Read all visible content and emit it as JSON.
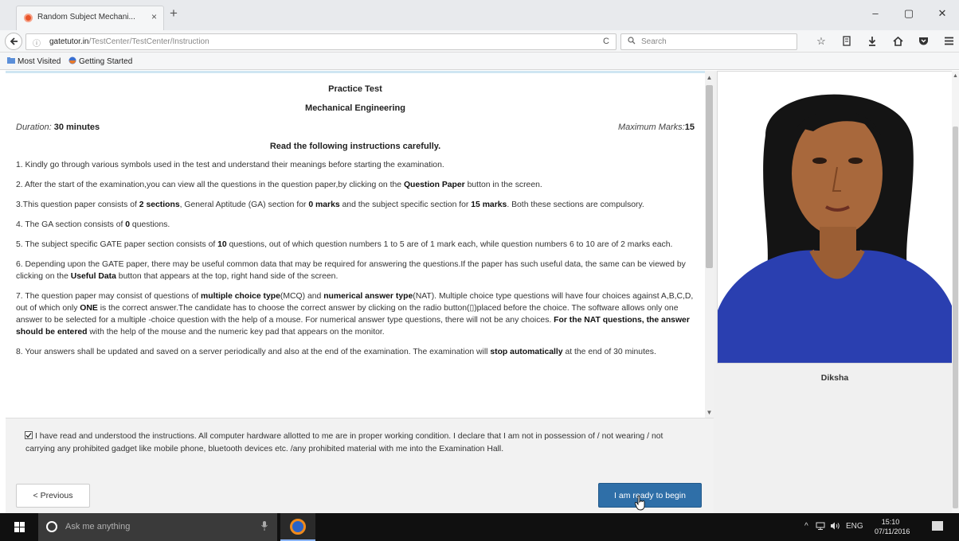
{
  "browser": {
    "tab_title": "Random Subject Mechani...",
    "tab_close": "×",
    "new_tab": "+",
    "window_controls": [
      "–",
      "▢",
      "✕"
    ],
    "url_info": "ⓘ",
    "url_host": "gatetutor.in",
    "url_path": "/TestCenter/TestCenter/Instruction",
    "reload": "C",
    "search_placeholder": "Search",
    "toolbar_icons": [
      "star-icon",
      "reading-list-icon",
      "download-icon",
      "home-icon",
      "pocket-icon",
      "menu-icon"
    ],
    "bookmarks": [
      "Most Visited",
      "Getting Started"
    ]
  },
  "test": {
    "title": "Practice Test",
    "subject": "Mechanical Engineering",
    "duration_label": "Duration:",
    "duration_value": "30 minutes",
    "marks_label": "Maximum Marks:",
    "marks_value": "15",
    "read_heading": "Read the following instructions carefully.",
    "instructions": [
      {
        "parts": [
          {
            "t": "1. Kindly go through various symbols used in the test and understand their meanings before starting the examination."
          }
        ]
      },
      {
        "parts": [
          {
            "t": "2. After the start of the examination,you can view all the questions in the question paper,by clicking on the "
          },
          {
            "t": "Question Paper",
            "b": true
          },
          {
            "t": " button in the screen."
          }
        ]
      },
      {
        "parts": [
          {
            "t": "3.This question paper consists of "
          },
          {
            "t": "2 sections",
            "b": true
          },
          {
            "t": ", General Aptitude (GA) section for "
          },
          {
            "t": "0 marks",
            "b": true
          },
          {
            "t": " and the subject specific section for "
          },
          {
            "t": "15 marks",
            "b": true
          },
          {
            "t": ". Both these sections are compulsory."
          }
        ]
      },
      {
        "parts": [
          {
            "t": "4. The GA section consists of "
          },
          {
            "t": "0",
            "b": true
          },
          {
            "t": " questions."
          }
        ]
      },
      {
        "parts": [
          {
            "t": "5. The subject specific GATE paper section consists of "
          },
          {
            "t": "10",
            "b": true
          },
          {
            "t": " questions, out of which question numbers 1 to 5 are of 1 mark each, while question numbers 6 to 10 are of 2 marks each."
          }
        ]
      },
      {
        "parts": [
          {
            "t": "6. Depending upon the GATE paper, there may be useful common data that may be required for answering the questions.If the paper has such useful data, the same can be viewed by clicking on the "
          },
          {
            "t": "Useful Data",
            "b": true
          },
          {
            "t": " button that appears at the top, right hand side of the screen."
          }
        ]
      },
      {
        "parts": [
          {
            "t": "7. The question paper may consist of questions of "
          },
          {
            "t": "multiple choice type",
            "b": true
          },
          {
            "t": "(MCQ) and "
          },
          {
            "t": "numerical answer type",
            "b": true
          },
          {
            "t": "(NAT). Multiple choice type questions will have four choices against A,B,C,D, out of which only "
          },
          {
            "t": "ONE",
            "b": true
          },
          {
            "t": " is the correct answer.The candidate has to choose the correct answer by clicking on the radio button(▯)placed before the choice. The software allows only one answer to be selected for a multiple -choice question with the help of a mouse. For numerical answer type questions, there will not be any choices. "
          },
          {
            "t": "For the NAT questions, the answer should be entered",
            "b": true
          },
          {
            "t": " with the help of the mouse and the numeric key pad that appears on the monitor."
          }
        ]
      },
      {
        "parts": [
          {
            "t": "8. Your answers shall be updated and saved on a server periodically and also at the end of the examination. The examination will "
          },
          {
            "t": "stop automatically",
            "b": true
          },
          {
            "t": " at the end of 30 minutes."
          }
        ]
      }
    ],
    "agreement": "I have read and understood the instructions. All computer hardware allotted to me are in proper working condition. I declare that I am not in possession of / not wearing / not carrying any prohibited gadget like mobile phone, bluetooth devices etc. /any prohibited material with me into the Examination Hall.",
    "agreement_checked": true,
    "previous_label": "< Previous",
    "ready_label": "I am ready to begin"
  },
  "candidate": {
    "name": "Diksha"
  },
  "taskbar": {
    "search_placeholder": "Ask me anything",
    "tray_lang": "ENG",
    "time": "15:10",
    "date": "07/11/2016"
  },
  "colors": {
    "primary_button": "#2f6fa8",
    "photo_shirt": "#2a3fb0"
  }
}
